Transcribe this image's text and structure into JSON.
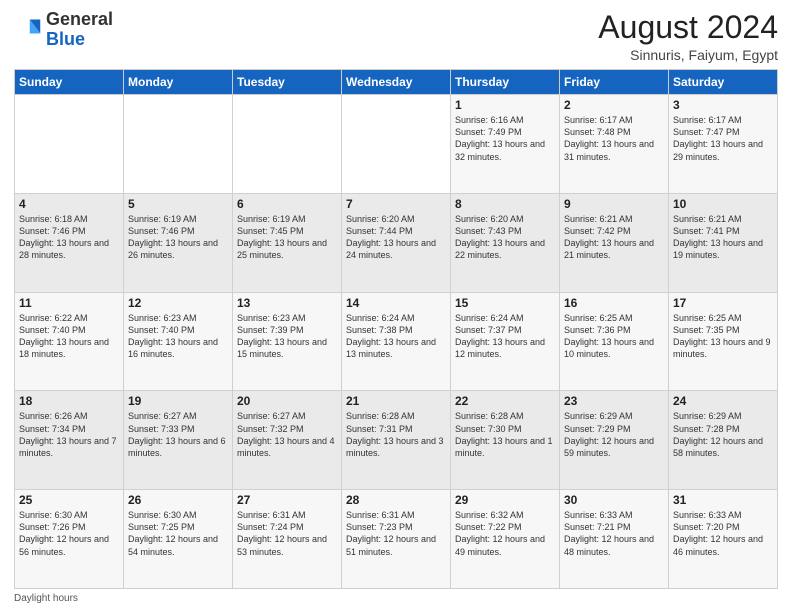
{
  "header": {
    "logo_general": "General",
    "logo_blue": "Blue",
    "month_year": "August 2024",
    "location": "Sinnuris, Faiyum, Egypt"
  },
  "weekdays": [
    "Sunday",
    "Monday",
    "Tuesday",
    "Wednesday",
    "Thursday",
    "Friday",
    "Saturday"
  ],
  "weeks": [
    [
      {
        "day": "",
        "content": ""
      },
      {
        "day": "",
        "content": ""
      },
      {
        "day": "",
        "content": ""
      },
      {
        "day": "",
        "content": ""
      },
      {
        "day": "1",
        "content": "Sunrise: 6:16 AM\nSunset: 7:49 PM\nDaylight: 13 hours\nand 32 minutes."
      },
      {
        "day": "2",
        "content": "Sunrise: 6:17 AM\nSunset: 7:48 PM\nDaylight: 13 hours\nand 31 minutes."
      },
      {
        "day": "3",
        "content": "Sunrise: 6:17 AM\nSunset: 7:47 PM\nDaylight: 13 hours\nand 29 minutes."
      }
    ],
    [
      {
        "day": "4",
        "content": "Sunrise: 6:18 AM\nSunset: 7:46 PM\nDaylight: 13 hours\nand 28 minutes."
      },
      {
        "day": "5",
        "content": "Sunrise: 6:19 AM\nSunset: 7:46 PM\nDaylight: 13 hours\nand 26 minutes."
      },
      {
        "day": "6",
        "content": "Sunrise: 6:19 AM\nSunset: 7:45 PM\nDaylight: 13 hours\nand 25 minutes."
      },
      {
        "day": "7",
        "content": "Sunrise: 6:20 AM\nSunset: 7:44 PM\nDaylight: 13 hours\nand 24 minutes."
      },
      {
        "day": "8",
        "content": "Sunrise: 6:20 AM\nSunset: 7:43 PM\nDaylight: 13 hours\nand 22 minutes."
      },
      {
        "day": "9",
        "content": "Sunrise: 6:21 AM\nSunset: 7:42 PM\nDaylight: 13 hours\nand 21 minutes."
      },
      {
        "day": "10",
        "content": "Sunrise: 6:21 AM\nSunset: 7:41 PM\nDaylight: 13 hours\nand 19 minutes."
      }
    ],
    [
      {
        "day": "11",
        "content": "Sunrise: 6:22 AM\nSunset: 7:40 PM\nDaylight: 13 hours\nand 18 minutes."
      },
      {
        "day": "12",
        "content": "Sunrise: 6:23 AM\nSunset: 7:40 PM\nDaylight: 13 hours\nand 16 minutes."
      },
      {
        "day": "13",
        "content": "Sunrise: 6:23 AM\nSunset: 7:39 PM\nDaylight: 13 hours\nand 15 minutes."
      },
      {
        "day": "14",
        "content": "Sunrise: 6:24 AM\nSunset: 7:38 PM\nDaylight: 13 hours\nand 13 minutes."
      },
      {
        "day": "15",
        "content": "Sunrise: 6:24 AM\nSunset: 7:37 PM\nDaylight: 13 hours\nand 12 minutes."
      },
      {
        "day": "16",
        "content": "Sunrise: 6:25 AM\nSunset: 7:36 PM\nDaylight: 13 hours\nand 10 minutes."
      },
      {
        "day": "17",
        "content": "Sunrise: 6:25 AM\nSunset: 7:35 PM\nDaylight: 13 hours\nand 9 minutes."
      }
    ],
    [
      {
        "day": "18",
        "content": "Sunrise: 6:26 AM\nSunset: 7:34 PM\nDaylight: 13 hours\nand 7 minutes."
      },
      {
        "day": "19",
        "content": "Sunrise: 6:27 AM\nSunset: 7:33 PM\nDaylight: 13 hours\nand 6 minutes."
      },
      {
        "day": "20",
        "content": "Sunrise: 6:27 AM\nSunset: 7:32 PM\nDaylight: 13 hours\nand 4 minutes."
      },
      {
        "day": "21",
        "content": "Sunrise: 6:28 AM\nSunset: 7:31 PM\nDaylight: 13 hours\nand 3 minutes."
      },
      {
        "day": "22",
        "content": "Sunrise: 6:28 AM\nSunset: 7:30 PM\nDaylight: 13 hours\nand 1 minute."
      },
      {
        "day": "23",
        "content": "Sunrise: 6:29 AM\nSunset: 7:29 PM\nDaylight: 12 hours\nand 59 minutes."
      },
      {
        "day": "24",
        "content": "Sunrise: 6:29 AM\nSunset: 7:28 PM\nDaylight: 12 hours\nand 58 minutes."
      }
    ],
    [
      {
        "day": "25",
        "content": "Sunrise: 6:30 AM\nSunset: 7:26 PM\nDaylight: 12 hours\nand 56 minutes."
      },
      {
        "day": "26",
        "content": "Sunrise: 6:30 AM\nSunset: 7:25 PM\nDaylight: 12 hours\nand 54 minutes."
      },
      {
        "day": "27",
        "content": "Sunrise: 6:31 AM\nSunset: 7:24 PM\nDaylight: 12 hours\nand 53 minutes."
      },
      {
        "day": "28",
        "content": "Sunrise: 6:31 AM\nSunset: 7:23 PM\nDaylight: 12 hours\nand 51 minutes."
      },
      {
        "day": "29",
        "content": "Sunrise: 6:32 AM\nSunset: 7:22 PM\nDaylight: 12 hours\nand 49 minutes."
      },
      {
        "day": "30",
        "content": "Sunrise: 6:33 AM\nSunset: 7:21 PM\nDaylight: 12 hours\nand 48 minutes."
      },
      {
        "day": "31",
        "content": "Sunrise: 6:33 AM\nSunset: 7:20 PM\nDaylight: 12 hours\nand 46 minutes."
      }
    ]
  ],
  "footer": {
    "note": "Daylight hours"
  }
}
